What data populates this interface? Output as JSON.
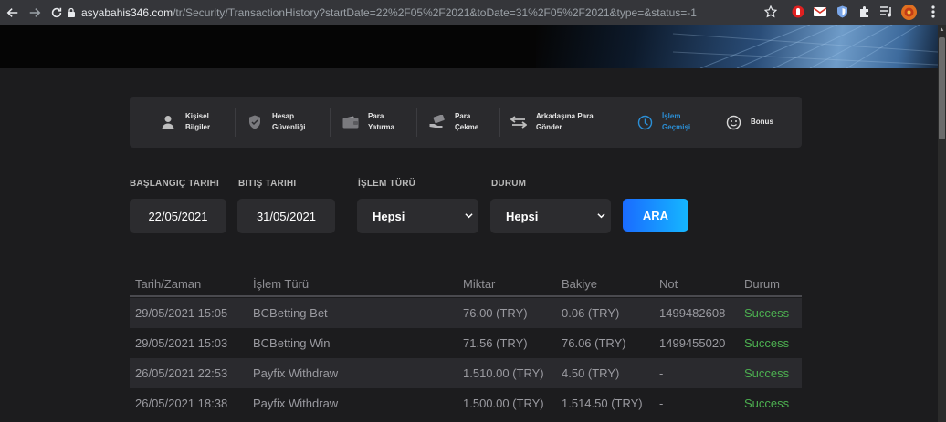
{
  "browser": {
    "url_host": "asyabahis346.com",
    "url_path": "/tr/Security/TransactionHistory?startDate=22%2F05%2F2021&toDate=31%2F05%2F2021&type=&status=-1"
  },
  "tabs": [
    {
      "label": "Kişisel\nBilgiler",
      "icon": "user-icon",
      "active": false
    },
    {
      "label": "Hesap\nGüvenliği",
      "icon": "shield-icon",
      "active": false
    },
    {
      "label": "Para\nYatırma",
      "icon": "wallet-icon",
      "active": false
    },
    {
      "label": "Para\nÇekme",
      "icon": "cash-hand-icon",
      "active": false
    },
    {
      "label": "Arkadaşına Para\nGönder",
      "icon": "transfer-arrows-icon",
      "active": false
    },
    {
      "label": "İşlem\nGeçmişi",
      "icon": "history-clock-icon",
      "active": true
    },
    {
      "label": "Bonus",
      "icon": "smile-icon",
      "active": false
    }
  ],
  "filters": {
    "start_label": "BAŞLANGIÇ TARIHI",
    "start_value": "22/05/2021",
    "end_label": "BITIŞ TARIHI",
    "end_value": "31/05/2021",
    "type_label": "İŞLEM TÜRÜ",
    "type_value": "Hepsi",
    "status_label": "DURUM",
    "status_value": "Hepsi",
    "search_button": "ARA"
  },
  "table": {
    "headers": [
      "Tarih/Zaman",
      "İşlem Türü",
      "Miktar",
      "Bakiye",
      "Not",
      "Durum"
    ],
    "rows": [
      [
        "29/05/2021 15:05",
        "BCBetting Bet",
        "76.00 (TRY)",
        "0.06 (TRY)",
        "1499482608",
        "Success"
      ],
      [
        "29/05/2021 15:03",
        "BCBetting Win",
        "71.56 (TRY)",
        "76.06 (TRY)",
        "1499455020",
        "Success"
      ],
      [
        "26/05/2021 22:53",
        "Payfix Withdraw",
        "1.510.00 (TRY)",
        "4.50 (TRY)",
        "-",
        "Success"
      ],
      [
        "26/05/2021 18:38",
        "Payfix Withdraw",
        "1.500.00 (TRY)",
        "1.514.50 (TRY)",
        "-",
        "Success"
      ]
    ]
  },
  "colors": {
    "accent": "#2b8fd6",
    "success": "#4caf50",
    "button_start": "#1a6bff",
    "button_end": "#15b7ff"
  }
}
